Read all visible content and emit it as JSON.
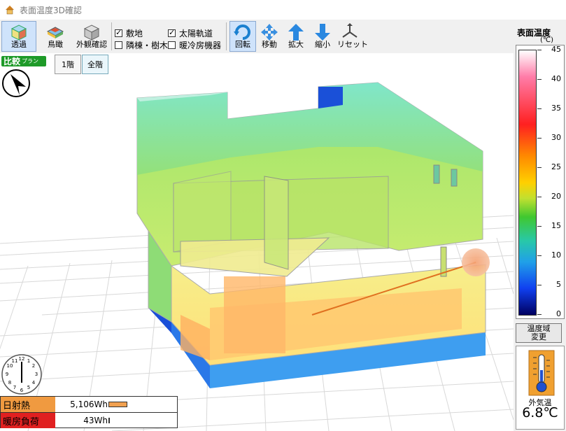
{
  "window": {
    "title": "表面温度3D確認"
  },
  "toolbar": {
    "view_modes": [
      {
        "label": "透過",
        "active": true
      },
      {
        "label": "鳥瞰",
        "active": false
      },
      {
        "label": "外観確認",
        "active": false
      }
    ],
    "checks": [
      {
        "label": "敷地",
        "checked": true
      },
      {
        "label": "太陽軌道",
        "checked": true
      },
      {
        "label": "隣棟・樹木",
        "checked": false
      },
      {
        "label": "暖冷房機器",
        "checked": false
      }
    ],
    "nav": [
      {
        "label": "回転",
        "active": true
      },
      {
        "label": "移動",
        "active": false
      },
      {
        "label": "拡大",
        "active": false
      },
      {
        "label": "縮小",
        "active": false
      },
      {
        "label": "リセット",
        "active": false
      }
    ]
  },
  "compare": {
    "label": "比較",
    "sub": "プラン"
  },
  "floors": [
    {
      "label": "1階",
      "active": false
    },
    {
      "label": "全階",
      "active": true
    }
  ],
  "stats": [
    {
      "label": "日射熱",
      "value": "5,106Wh",
      "color": "#f09a40",
      "bar_fraction": 0.28
    },
    {
      "label": "暖房負荷",
      "value": "43Wh",
      "color": "#e02020",
      "bar_fraction": 0.01
    }
  ],
  "legend": {
    "title": "表面温度",
    "unit": "(℃)",
    "ticks": [
      "45",
      "40",
      "35",
      "30",
      "25",
      "20",
      "15",
      "10",
      "5",
      "0"
    ],
    "range_button": [
      "温度域",
      "変更"
    ]
  },
  "outside": {
    "label": "外気温",
    "value": "6.8℃"
  },
  "colors": {
    "active_button": "#cfe3fb",
    "compare_badge": "#1e9a28",
    "solar_bar": "#f09a40",
    "heating_bar": "#e02020"
  }
}
